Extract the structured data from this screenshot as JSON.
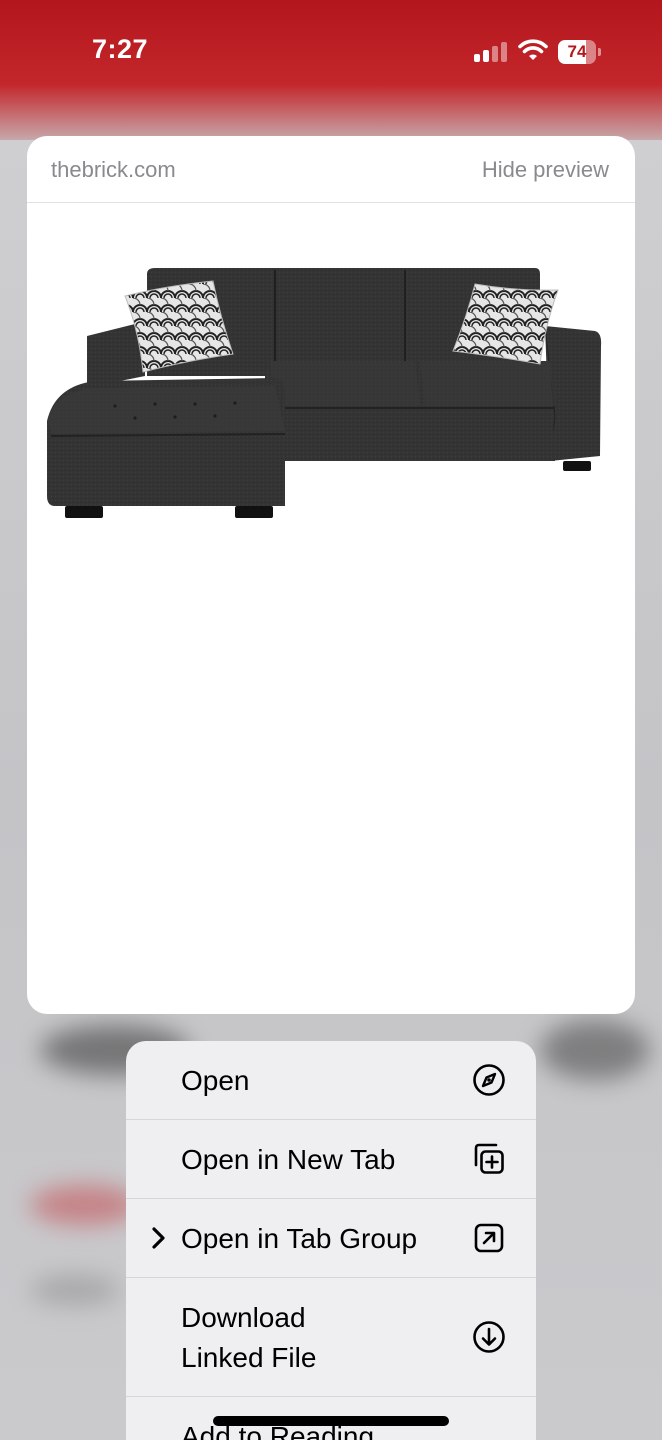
{
  "status_bar": {
    "time": "7:27",
    "battery_percent": "74",
    "battery_level": 0.74,
    "signal_bars_active": 2
  },
  "preview": {
    "domain": "thebrick.com",
    "hide_label": "Hide preview",
    "image_icon": "sectional-sofa-image"
  },
  "menu": {
    "items": [
      {
        "label": "Open",
        "icon": "compass-icon"
      },
      {
        "label": "Open in New Tab",
        "icon": "new-tab-icon"
      },
      {
        "label": "Open in Tab Group",
        "icon": "tab-group-arrow-icon",
        "has_submenu": true
      },
      {
        "label_line1": "Download",
        "label_line2": "Linked File",
        "icon": "download-icon"
      },
      {
        "label": "Add to Reading",
        "icon": "reading-list-icon"
      }
    ]
  },
  "colors": {
    "accent_red": "#b3161c",
    "menu_bg": "#efeff1",
    "secondary_text": "#8a8a8e"
  }
}
